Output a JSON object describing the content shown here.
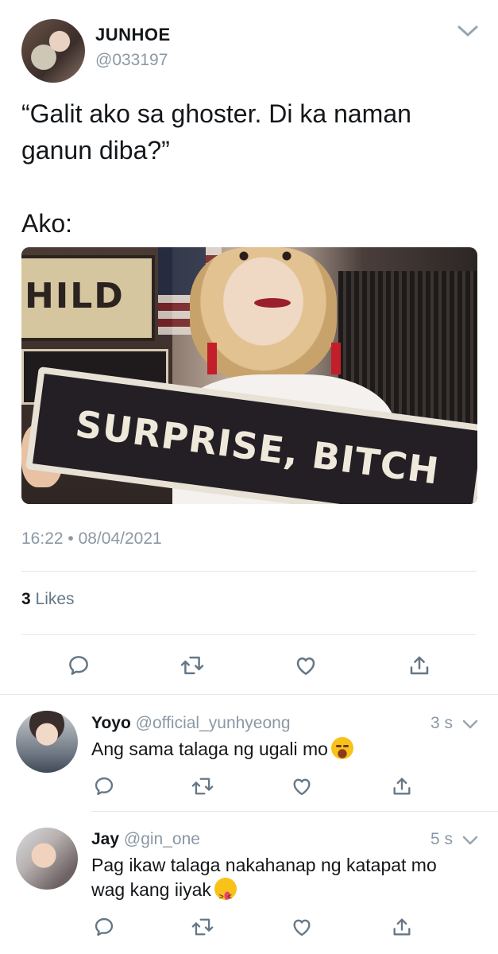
{
  "tweet": {
    "author_name": "JUNHOE",
    "author_handle": "@033197",
    "text": "“Galit ako sa ghoster. Di ka naman ganun diba?”\n\nAko:",
    "media": {
      "sign_text": "SURPRISE, BITCH",
      "background_sign_text": "HILD"
    },
    "timestamp": "16:22 • 08/04/2021",
    "likes_count": "3",
    "likes_label": " Likes"
  },
  "actions": {
    "icons": [
      "reply-icon",
      "retweet-icon",
      "like-icon",
      "share-icon"
    ]
  },
  "replies": [
    {
      "name": "Yoyo",
      "handle": " @official_yunhyeong",
      "time": "3 s",
      "text": "Ang sama talaga ng ugali mo",
      "emoji": "face-with-tears-of-joy"
    },
    {
      "name": "Jay",
      "handle": " @gin_one",
      "time": "5 s",
      "text": "Pag ikaw talaga nakahanap ng katapat mo wag kang iiyak",
      "emoji": "squinting-face-with-tongue"
    }
  ],
  "colors": {
    "text": "#14171a",
    "secondary": "#8b98a5",
    "icon": "#657786",
    "divider": "#e1e8ed"
  }
}
